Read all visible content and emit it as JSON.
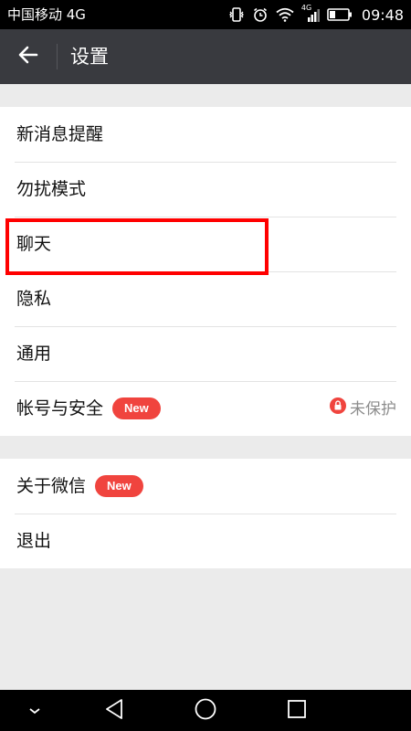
{
  "status_bar": {
    "carrier": "中国移动 4G",
    "network_label": "4G",
    "time": "09:48"
  },
  "header": {
    "title": "设置",
    "back_icon": "arrow-left-icon"
  },
  "settings_group_1": [
    {
      "label": "新消息提醒"
    },
    {
      "label": "勿扰模式"
    },
    {
      "label": "聊天"
    },
    {
      "label": "隐私"
    },
    {
      "label": "通用"
    },
    {
      "label": "帐号与安全",
      "badge": "New",
      "status": "未保护",
      "status_icon": "lock-icon"
    }
  ],
  "settings_group_2": [
    {
      "label": "关于微信",
      "badge": "New"
    },
    {
      "label": "退出"
    }
  ],
  "colors": {
    "title_bar": "#393a3f",
    "badge": "#f0443e",
    "highlight": "#ff0000",
    "background": "#ebebeb"
  }
}
